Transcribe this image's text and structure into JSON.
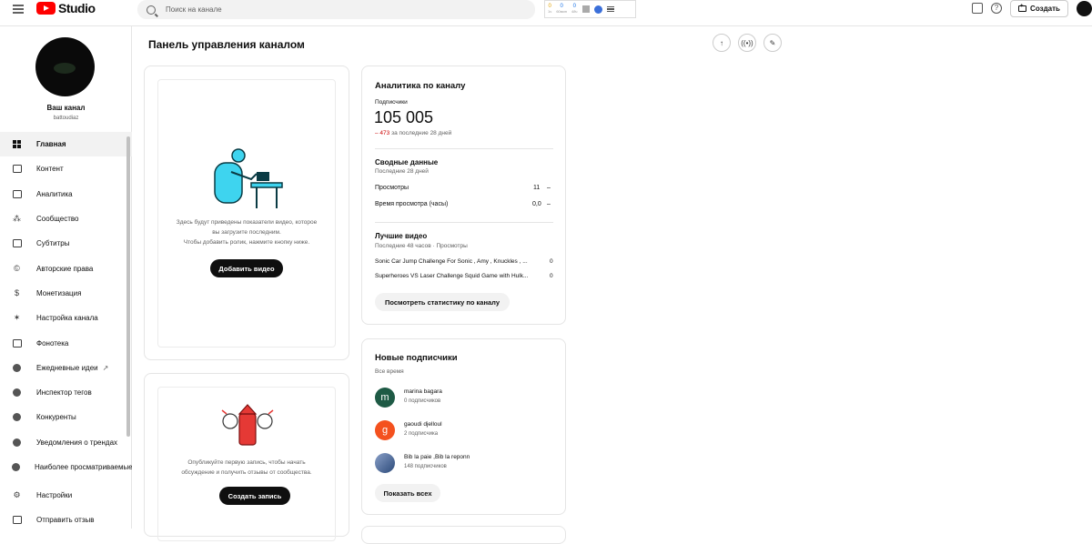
{
  "header": {
    "logo_text": "Studio",
    "search_placeholder": "Поиск на канале",
    "create_label": "Создать",
    "extension": {
      "v1": "0",
      "v2": "0",
      "v3": "0",
      "l1": "1ч",
      "l2": "60мин",
      "l3": "48ч"
    }
  },
  "channel": {
    "title": "Ваш канал",
    "handle": "battoudiaz"
  },
  "sidebar": {
    "items": [
      {
        "label": "Главная",
        "icon": "dashboard-icon"
      },
      {
        "label": "Контент",
        "icon": "content-icon"
      },
      {
        "label": "Аналитика",
        "icon": "analytics-icon"
      },
      {
        "label": "Сообщество",
        "icon": "community-icon"
      },
      {
        "label": "Субтитры",
        "icon": "subtitles-icon"
      },
      {
        "label": "Авторские права",
        "icon": "copyright-icon"
      },
      {
        "label": "Монетизация",
        "icon": "dollar-icon"
      },
      {
        "label": "Настройка канала",
        "icon": "magic-wand-icon"
      },
      {
        "label": "Фонотека",
        "icon": "audio-library-icon"
      },
      {
        "label": "Ежедневные идеи",
        "icon": "extension-icon"
      },
      {
        "label": "Инспектор тегов",
        "icon": "extension-icon"
      },
      {
        "label": "Конкуренты",
        "icon": "extension-icon"
      },
      {
        "label": "Уведомления о трендах",
        "icon": "extension-icon"
      },
      {
        "label": "Наиболее просматриваемые",
        "icon": "extension-icon"
      }
    ],
    "bottom": [
      {
        "label": "Настройки",
        "icon": "gear-icon"
      },
      {
        "label": "Отправить отзыв",
        "icon": "feedback-icon"
      }
    ]
  },
  "main": {
    "title": "Панель управления каналом",
    "upload_card": {
      "line1": "Здесь будут приведены показатели видео, которое",
      "line2": "вы загрузите последним.",
      "line3": "Чтобы добавить ролик, нажмите кнопку ниже.",
      "button": "Добавить видео"
    },
    "post_card": {
      "line1": "Опубликуйте первую запись, чтобы начать",
      "line2": "обсуждение и получить отзывы от сообщества.",
      "button": "Создать запись"
    },
    "analytics": {
      "title": "Аналитика по каналу",
      "subs_label": "Подписчики",
      "subs_value": "105 005",
      "delta_value": "– 473",
      "delta_suffix": " за последние 28 дней",
      "summary_title": "Сводные данные",
      "summary_period": "Последние 28 дней",
      "views_label": "Просмотры",
      "views_value": "11",
      "watch_label": "Время просмотра (часы)",
      "watch_value": "0,0",
      "trend_dash": "–",
      "top_title": "Лучшие видео",
      "top_period": "Последние 48 часов · Просмотры",
      "top_videos": [
        {
          "title": "Sonic Car Jump Challenge For Sonic , Amy , Knuckles , ...",
          "views": "0"
        },
        {
          "title": "Superheroes VS Laser Challenge Squid Game with Hulk...",
          "views": "0"
        }
      ],
      "button": "Посмотреть статистику по каналу"
    },
    "subscribers": {
      "title": "Новые подписчики",
      "period": "Все время",
      "list": [
        {
          "name": "marina bagara",
          "count": "0 подписчиков",
          "initial": "m",
          "color": "#1e5a45"
        },
        {
          "name": "gaoudi djelloul",
          "count": "2 подписчика",
          "initial": "g",
          "color": "#f4511e"
        },
        {
          "name": "Bib la paie ,Bib la reponn",
          "count": "148 подписчиков",
          "initial": "",
          "color": "#4a6fa5"
        }
      ],
      "button": "Показать всех"
    }
  }
}
